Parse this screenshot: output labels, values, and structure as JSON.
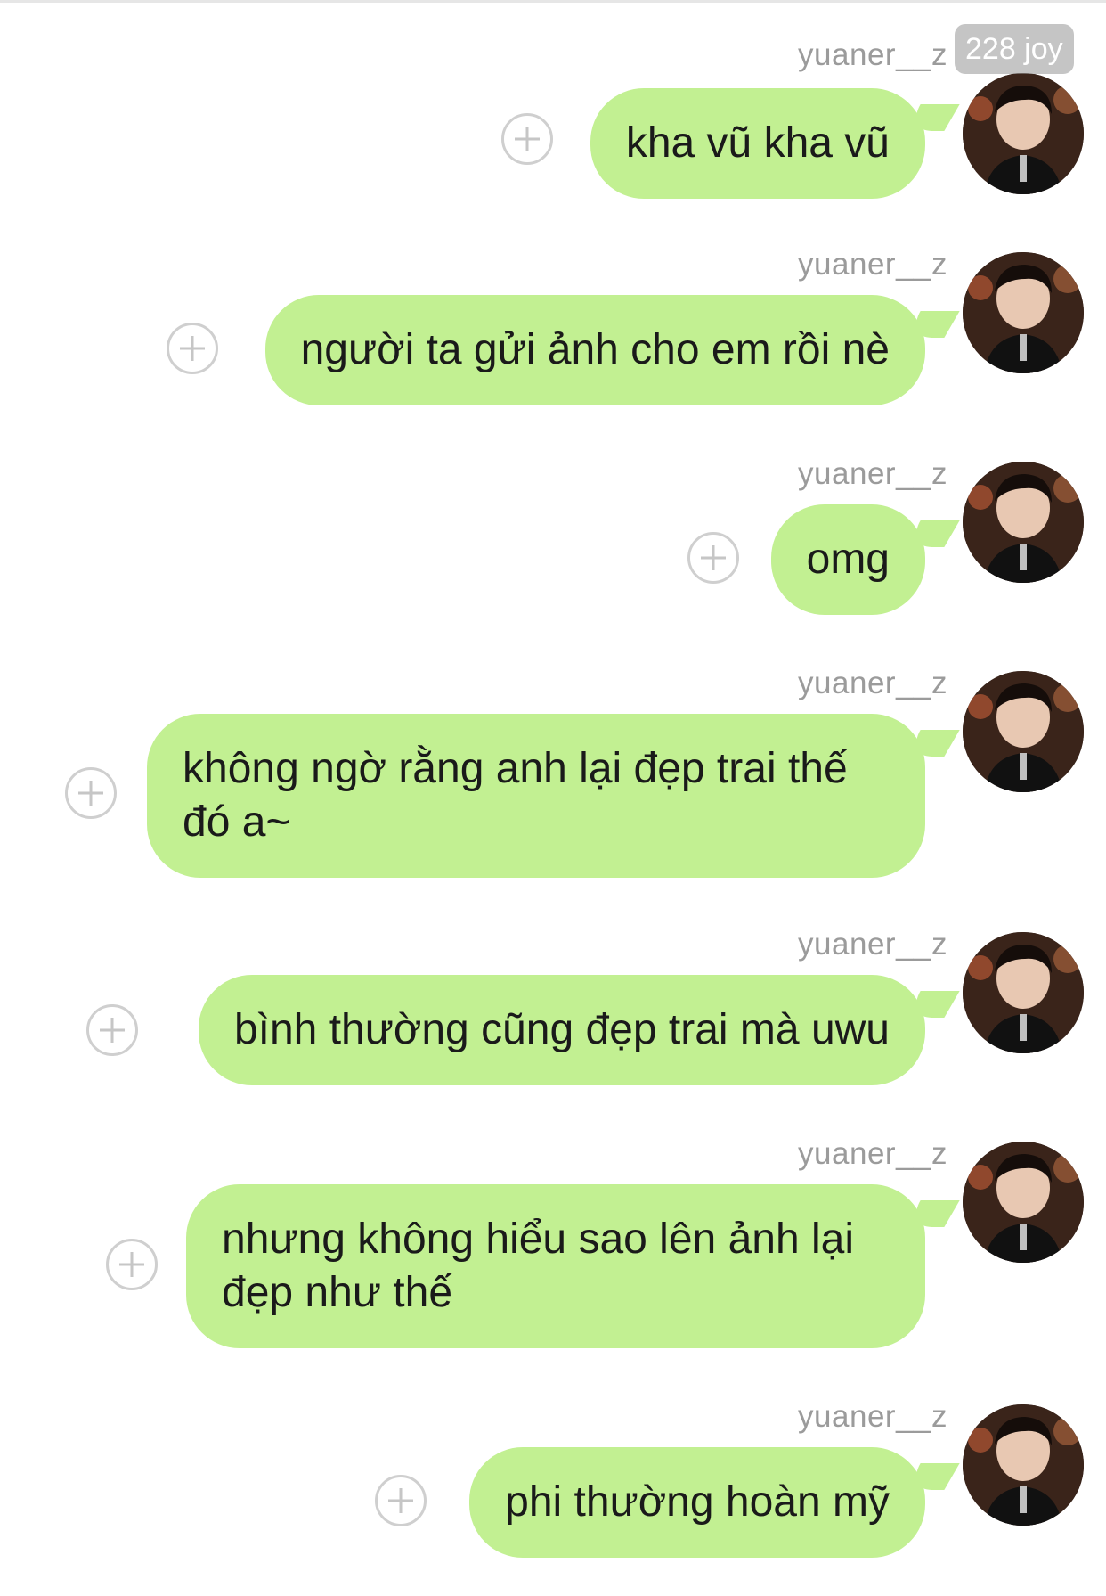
{
  "thread": {
    "messages": [
      {
        "sender": "yuaner__z",
        "text": "kha vũ kha vũ"
      },
      {
        "sender": "yuaner__z",
        "text": "người ta gửi ảnh cho em rồi nè"
      },
      {
        "sender": "yuaner__z",
        "text": "omg"
      },
      {
        "sender": "yuaner__z",
        "text": "không ngờ rằng anh lại đẹp trai thế đó a~"
      },
      {
        "sender": "yuaner__z",
        "text": "bình thường cũng đẹp trai mà uwu"
      },
      {
        "sender": "yuaner__z",
        "text": "nhưng không hiểu sao lên ảnh lại đẹp như thế"
      },
      {
        "sender": "yuaner__z",
        "text": "phi thường hoàn mỹ"
      }
    ]
  },
  "overlay": {
    "badge": "228 joy"
  },
  "colors": {
    "bubble": "#c2f092",
    "username": "#9b9b9b",
    "add_button": "#cfcfcf"
  },
  "icons": {
    "add": "plus-circle-icon"
  }
}
